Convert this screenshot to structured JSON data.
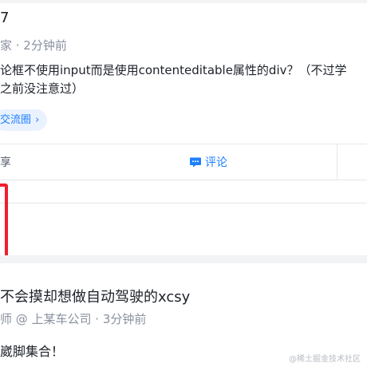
{
  "post1": {
    "author": "7",
    "meta": "家 · 2分钟前",
    "content_line1": "论框不使用input而是使用contenteditable属性的div？（不过学",
    "content_line2": "之前没注意过）",
    "tag_label": "交流圈",
    "tag_chevron": "›",
    "share_label": "享",
    "comment_label": "评论"
  },
  "post2": {
    "author": "不会摸却想做自动驾驶的xcsy",
    "meta": "师 @ 上某车公司 · 3分钟前",
    "content": "崴脚集合！"
  },
  "watermark": "@稀土掘金技术社区",
  "colors": {
    "accent": "#1e80ff",
    "highlight_box": "#f01f2d",
    "text_primary": "#1d2129",
    "text_secondary": "#8a919f",
    "page_background": "#f2f3f5"
  }
}
